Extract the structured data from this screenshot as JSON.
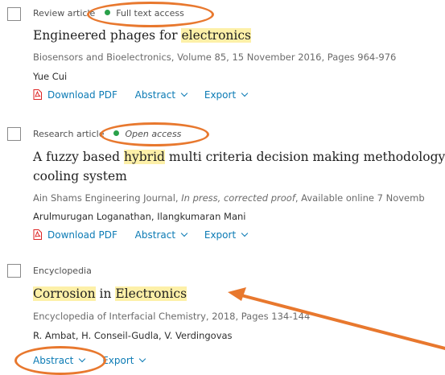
{
  "results": [
    {
      "type": "Review article",
      "access": "Full text access",
      "access_style": "normal",
      "title_parts": [
        "Engineered phages for ",
        "electronics"
      ],
      "source": "Biosensors and Bioelectronics, Volume 85, 15 November 2016, Pages 964-976",
      "authors": "Yue Cui",
      "actions": {
        "pdf": "Download PDF",
        "abstract": "Abstract",
        "export": "Export"
      }
    },
    {
      "type": "Research article",
      "access": "Open access",
      "access_style": "italic",
      "title_line1_parts": [
        "A fuzzy based ",
        "hybrid",
        " multi criteria decision making methodology fo"
      ],
      "title_line2": "cooling system",
      "source_prefix": "Ain Shams Engineering Journal, ",
      "source_italic": "In press, corrected proof",
      "source_suffix": ", Available online 7 Novemb",
      "authors": "Arulmurugan Loganathan, Ilangkumaran Mani",
      "actions": {
        "pdf": "Download PDF",
        "abstract": "Abstract",
        "export": "Export"
      }
    },
    {
      "type": "Encyclopedia",
      "title_parts": [
        "Corrosion",
        " in ",
        "Electronics"
      ],
      "source": "Encyclopedia of Interfacial Chemistry, 2018, Pages 134-144",
      "authors": "R. Ambat, H. Conseil-Gudla, V. Verdingovas",
      "actions": {
        "abstract": "Abstract",
        "export": "Export"
      }
    }
  ],
  "colors": {
    "link": "#0c7bb5",
    "open_dot": "#2aa14a",
    "highlight": "#fdf0a8",
    "annotation": "#e8782e"
  }
}
